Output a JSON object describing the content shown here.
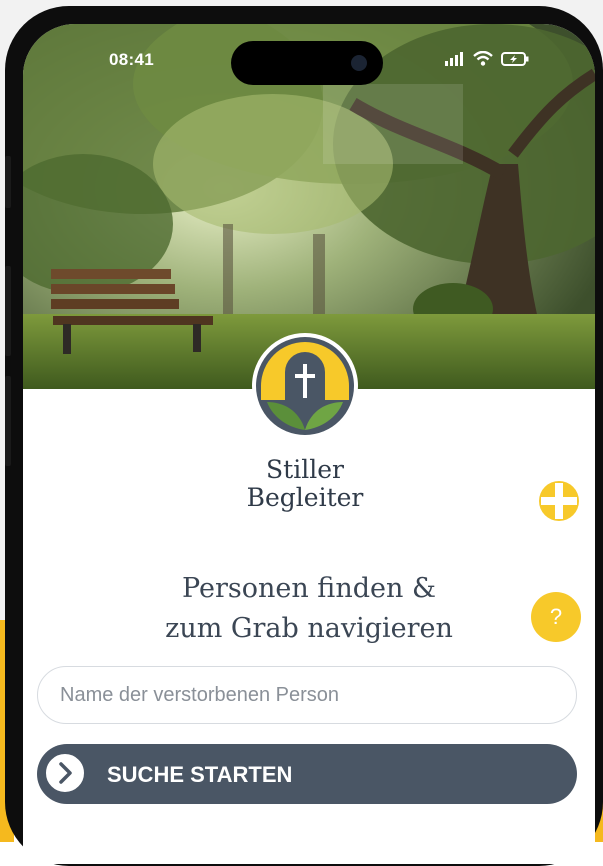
{
  "status_bar": {
    "time": "08:41",
    "icons": [
      "signal-icon",
      "wifi-icon",
      "battery-icon"
    ]
  },
  "brand": {
    "line1": "Stiller",
    "line2": "Begleiter",
    "logo_icon": "cross-gravestone-leaves-icon"
  },
  "headline": {
    "line1": "Personen finden &",
    "line2": "zum Grab navigieren"
  },
  "search": {
    "placeholder": "Name der verstorbenen Person",
    "value": ""
  },
  "search_button": {
    "label": "SUCHE STARTEN",
    "icon": "chevron-right-icon"
  },
  "floating_buttons": {
    "cross_icon": "plus-cross-icon",
    "help_label": "?"
  },
  "colors": {
    "accent_yellow": "#f7c92a",
    "slate": "#4a5665",
    "text": "#3b4654"
  }
}
